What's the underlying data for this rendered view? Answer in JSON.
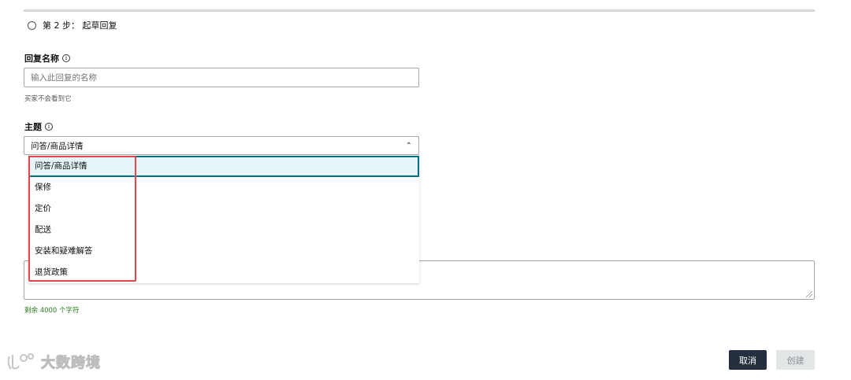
{
  "step": {
    "label": "第 2 步：  起草回复"
  },
  "reply_name": {
    "label": "回复名称",
    "placeholder": "输入此回复的名称",
    "hint": "买家不会看到它"
  },
  "topic": {
    "label": "主题",
    "selected_value": "问答/商品详情",
    "options": [
      {
        "label": "问答/商品详情",
        "selected": true
      },
      {
        "label": "保修",
        "selected": false
      },
      {
        "label": "定价",
        "selected": false
      },
      {
        "label": "配送",
        "selected": false
      },
      {
        "label": "安装和疑难解答",
        "selected": false
      },
      {
        "label": "退货政策",
        "selected": false
      }
    ]
  },
  "message": {
    "remaining": "剩余 4000 个字符"
  },
  "actions": {
    "cancel": "取消",
    "create": "创建"
  },
  "watermark": {
    "text": "大数跨境"
  },
  "colors": {
    "accent": "#007185",
    "selected_bg": "#e6f6f8",
    "highlight": "#e3474d",
    "primary_button": "#232f3e",
    "disabled_button": "#e3e6e6",
    "success_text": "#2a7a1d"
  },
  "icons": {
    "info": "info-icon",
    "chevron": "chevron-up-icon",
    "radio": "radio-icon"
  }
}
